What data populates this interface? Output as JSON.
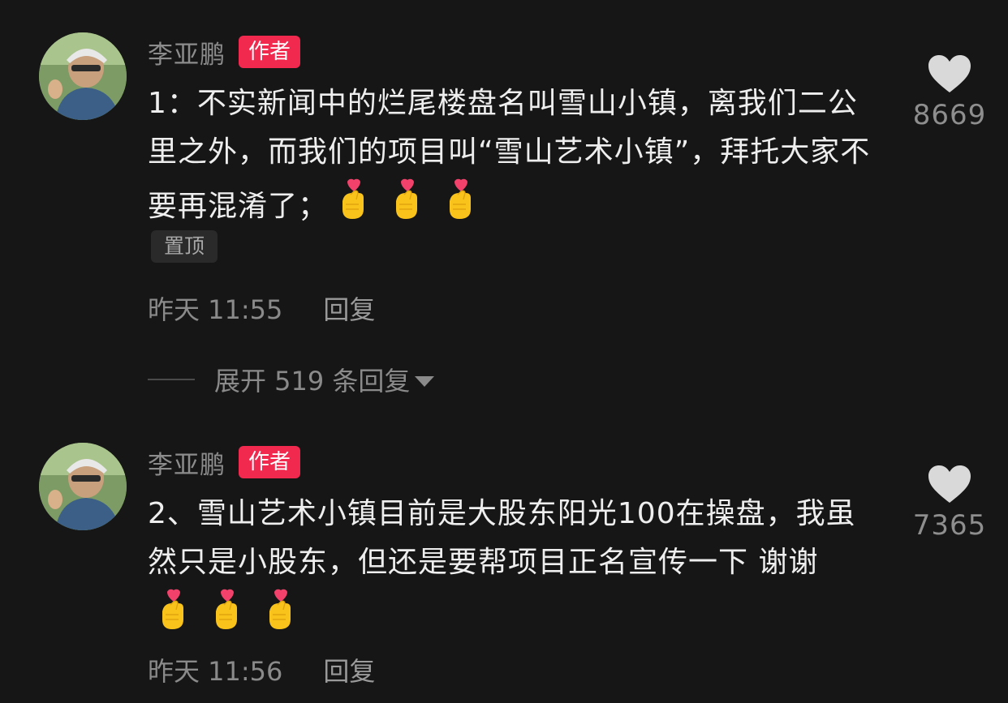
{
  "comments": [
    {
      "username": "李亚鹏",
      "badge": "作者",
      "text": "1：不实新闻中的烂尾楼盘名叫雪山小镇，离我们二公里之外，而我们的项目叫“雪山艺术小镇”，拜托大家不要再混淆了；",
      "emoji": [
        "heart-finger-emoji",
        "heart-finger-emoji",
        "heart-finger-emoji"
      ],
      "pinned_label": "置顶",
      "time": "昨天 11:55",
      "reply_label": "回复",
      "expand_label": "展开 519 条回复",
      "likes": "8669"
    },
    {
      "username": "李亚鹏",
      "badge": "作者",
      "text": "2、雪山艺术小镇目前是大股东阳光100在操盘，我虽然只是小股东，但还是要帮项目正名宣传一下 谢谢",
      "emoji": [
        "heart-finger-emoji",
        "heart-finger-emoji",
        "heart-finger-emoji"
      ],
      "time": "昨天 11:56",
      "reply_label": "回复",
      "likes": "7365"
    }
  ],
  "colors": {
    "background": "#161616",
    "badge": "#f1294f",
    "text": "#eeeeee",
    "muted": "#8a8a8a",
    "heart": "#d9d9d9"
  }
}
